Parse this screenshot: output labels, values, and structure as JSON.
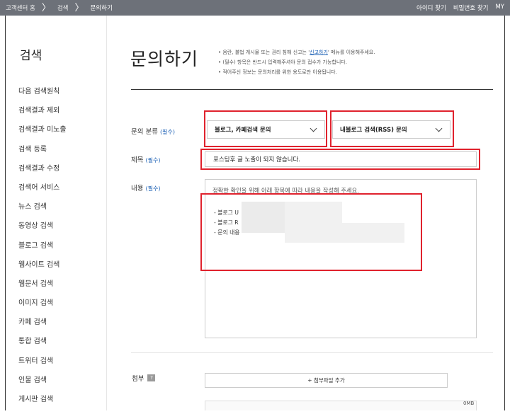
{
  "breadcrumb": {
    "items": [
      "고객센터 홈",
      "검색",
      "문의하기"
    ],
    "separator": "〉"
  },
  "top_links": [
    "아이디 찾기",
    "비밀번호 찾기",
    "MY"
  ],
  "sidebar": {
    "title": "검색",
    "items": [
      "다음 검색원칙",
      "검색결과 제외",
      "검색결과 미노출",
      "검색 등록",
      "검색결과 수정",
      "검색어 서비스",
      "뉴스 검색",
      "동영상 검색",
      "블로그 검색",
      "웹사이트 검색",
      "웹문서 검색",
      "이미지 검색",
      "카페 검색",
      "통합 검색",
      "트위터 검색",
      "인물 검색",
      "게시판 검색"
    ]
  },
  "page": {
    "title": "문의하기",
    "notices": {
      "line1_before": "음란, 불법 게시물 또는 권리 침해 신고는 '",
      "line1_link": "신고하기",
      "line1_after": "' 메뉴를 이용해주세요.",
      "line2": "(필수) 항목은 반드시 입력해주셔야 문의 접수가 가능합니다.",
      "line3": "적어주신 정보는 문의처리를 위한 용도로만 이용됩니다."
    }
  },
  "form": {
    "required_tag": "(필수)",
    "category": {
      "label": "문의 분류",
      "select1_value": "블로그, 카페검색 문의",
      "select2_value": "내블로그 검색(RSS) 문의"
    },
    "title": {
      "label": "제목",
      "value": "포스팅후 글 노출이 되지 않습니다."
    },
    "content": {
      "label": "내용",
      "guide": "정확한 확인을 위해 아래 항목에 따라 내용을 작성해 주세요.",
      "lines": [
        "- 블로그 U",
        "- 블로그 R",
        "- 문의 내용"
      ]
    },
    "attachment": {
      "label": "첨부",
      "help_icon": "question-icon",
      "button_label": "+ 첨부파일 추가",
      "size_text": "0MB"
    }
  },
  "colors": {
    "topbar": "#6d7179",
    "highlight": "#e0222d",
    "required": "#1a5fb4"
  }
}
